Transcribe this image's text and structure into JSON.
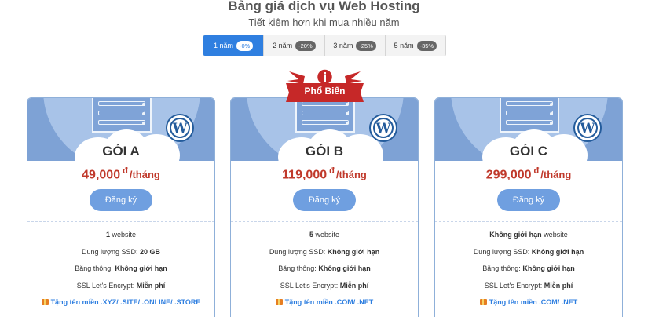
{
  "header": {
    "title": "Bảng giá dịch vụ Web Hosting",
    "subtitle": "Tiết kiệm hơn khi mua nhiều năm"
  },
  "tabs": [
    {
      "label": "1 năm",
      "discount": "-0%",
      "active": true
    },
    {
      "label": "2 năm",
      "discount": "-20%",
      "active": false
    },
    {
      "label": "3 năm",
      "discount": "-25%",
      "active": false
    },
    {
      "label": "5 năm",
      "discount": "-35%",
      "active": false
    }
  ],
  "ribbon": {
    "label": "Phổ Biến"
  },
  "plans": [
    {
      "name": "GÓI A",
      "price": "49,000",
      "currency": "đ",
      "period": "/tháng",
      "button": "Đăng ký",
      "websites_value": "1",
      "websites_label": "website",
      "ssd_label": "Dung lượng SSD:",
      "ssd_value": "20 GB",
      "bandwidth_label": "Băng thông:",
      "bandwidth_value": "Không giới hạn",
      "ssl_label": "SSL Let's Encrypt:",
      "ssl_value": "Miễn phí",
      "gift": "Tặng tên miền .XYZ/ .SITE/ .ONLINE/ .STORE"
    },
    {
      "name": "GÓI B",
      "price": "119,000",
      "currency": "đ",
      "period": "/tháng",
      "button": "Đăng ký",
      "websites_value": "5",
      "websites_label": "website",
      "ssd_label": "Dung lượng SSD:",
      "ssd_value": "Không giới hạn",
      "bandwidth_label": "Băng thông:",
      "bandwidth_value": "Không giới hạn",
      "ssl_label": "SSL Let's Encrypt:",
      "ssl_value": "Miễn phí",
      "gift": "Tặng tên miền .COM/ .NET"
    },
    {
      "name": "GÓI C",
      "price": "299,000",
      "currency": "đ",
      "period": "/tháng",
      "button": "Đăng ký",
      "websites_value": "Không giới hạn",
      "websites_label": "website",
      "ssd_label": "Dung lượng SSD:",
      "ssd_value": "Không giới hạn",
      "bandwidth_label": "Băng thông:",
      "bandwidth_value": "Không giới hạn",
      "ssl_label": "SSL Let's Encrypt:",
      "ssl_value": "Miễn phí",
      "gift": "Tặng tên miền .COM/ .NET"
    }
  ],
  "colors": {
    "accent": "#2f7fe0",
    "button": "#6f9fe0",
    "price": "#c0392b",
    "ribbon": "#c62828",
    "card_header": "#7ea2d5"
  }
}
